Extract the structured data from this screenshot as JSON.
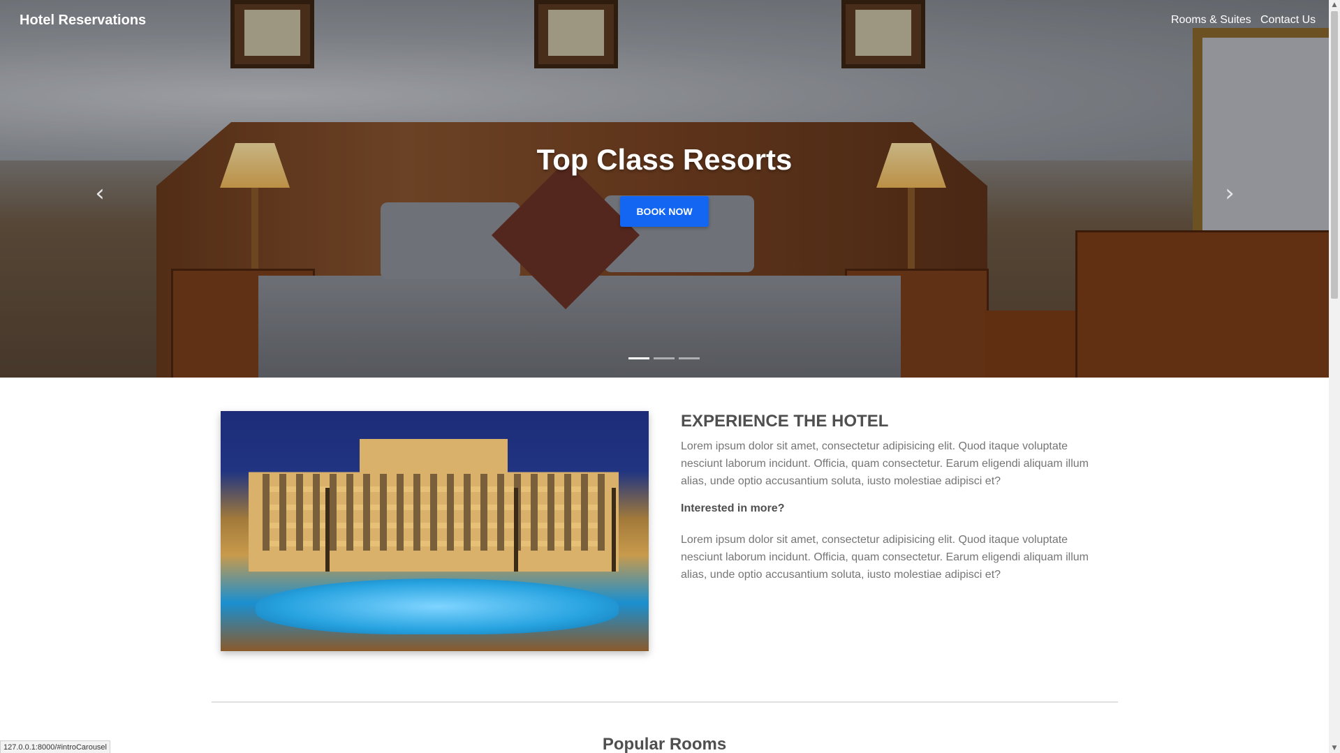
{
  "navbar": {
    "brand": "Hotel Reservations",
    "links": [
      "Rooms & Suites",
      "Contact Us"
    ]
  },
  "carousel": {
    "title": "Top Class Resorts",
    "button_label": "BOOK NOW",
    "prev_icon": "chevron-left-icon",
    "next_icon": "chevron-right-icon",
    "indicator_count": 3,
    "active_indicator": 0
  },
  "about": {
    "title": "EXPERIENCE THE HOTEL",
    "paragraph1": "Lorem ipsum dolor sit amet, consectetur adipisicing elit. Quod itaque voluptate nesciunt laborum incidunt. Officia, quam consectetur. Earum eligendi aliquam illum alias, unde optio accusantium soluta, iusto molestiae adipisci et?",
    "interested": "Interested in more?",
    "paragraph2": "Lorem ipsum dolor sit amet, consectetur adipisicing elit. Quod itaque voluptate nesciunt laborum incidunt. Officia, quam consectetur. Earum eligendi aliquam illum alias, unde optio accusantium soluta, iusto molestiae adipisci et?"
  },
  "popular": {
    "title": "Popular Rooms"
  },
  "status_bar": {
    "url": "127.0.0.1:8000/#introCarousel"
  },
  "colors": {
    "primary_button": "#1266f1",
    "heading_text": "#4f4f4f",
    "body_text": "#757575"
  }
}
